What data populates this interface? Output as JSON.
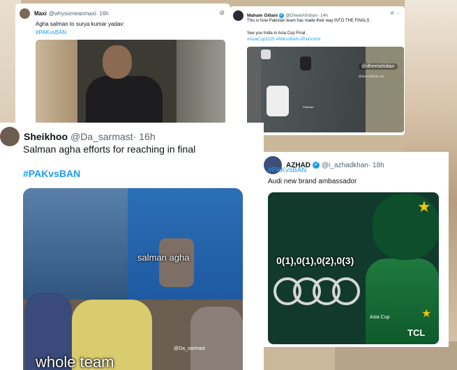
{
  "tweets": [
    {
      "name": "Maxi",
      "handle": "@whysomeanmaxi",
      "time": "· 16h",
      "text": "Agha salman to surya kumar yadav:",
      "hashtags": "#PAKvsBAN"
    },
    {
      "name": "Maham Gillani",
      "handle": "@DheetAfridian",
      "time": "· 14h",
      "text": "This is how Pakistan team has made their way INTO THE FINALS .",
      "text2": "See you India in Asia Cup Final .",
      "hashtags": "#AsiaCup2025 #PAKvsBAN #PakVsInd",
      "watermark": "@dheetafridian",
      "watermark2": "@MAHAMGILANI_",
      "watermark3": "Pakistan"
    },
    {
      "name": "Sheikhoo",
      "handle": "@Da_sarmast",
      "time": "· 16h",
      "text": "Salman agha efforts for reaching in final",
      "hashtags": "#PAKvsBAN",
      "meme_label": "salman agha",
      "meme_credit": "@Da_sarmast",
      "meme_bottom": "whole team"
    },
    {
      "name": "AZHAD",
      "handle": "@i_azhadkhan",
      "time": "· 18h",
      "hashtags": "#PAKvsBAN",
      "text": "Audi new brand ambassador",
      "scores": "0(1),0(1),0(2),0(3)",
      "sponsor": "TCL",
      "event": "Asia Cup"
    }
  ],
  "icons": {
    "grok": "grok-icon",
    "more": "more-icon",
    "verified": "verified-icon",
    "star": "star-icon"
  },
  "colors": {
    "hashtag": "#1d9bf0",
    "name": "#0f1419",
    "handle": "#536471"
  }
}
